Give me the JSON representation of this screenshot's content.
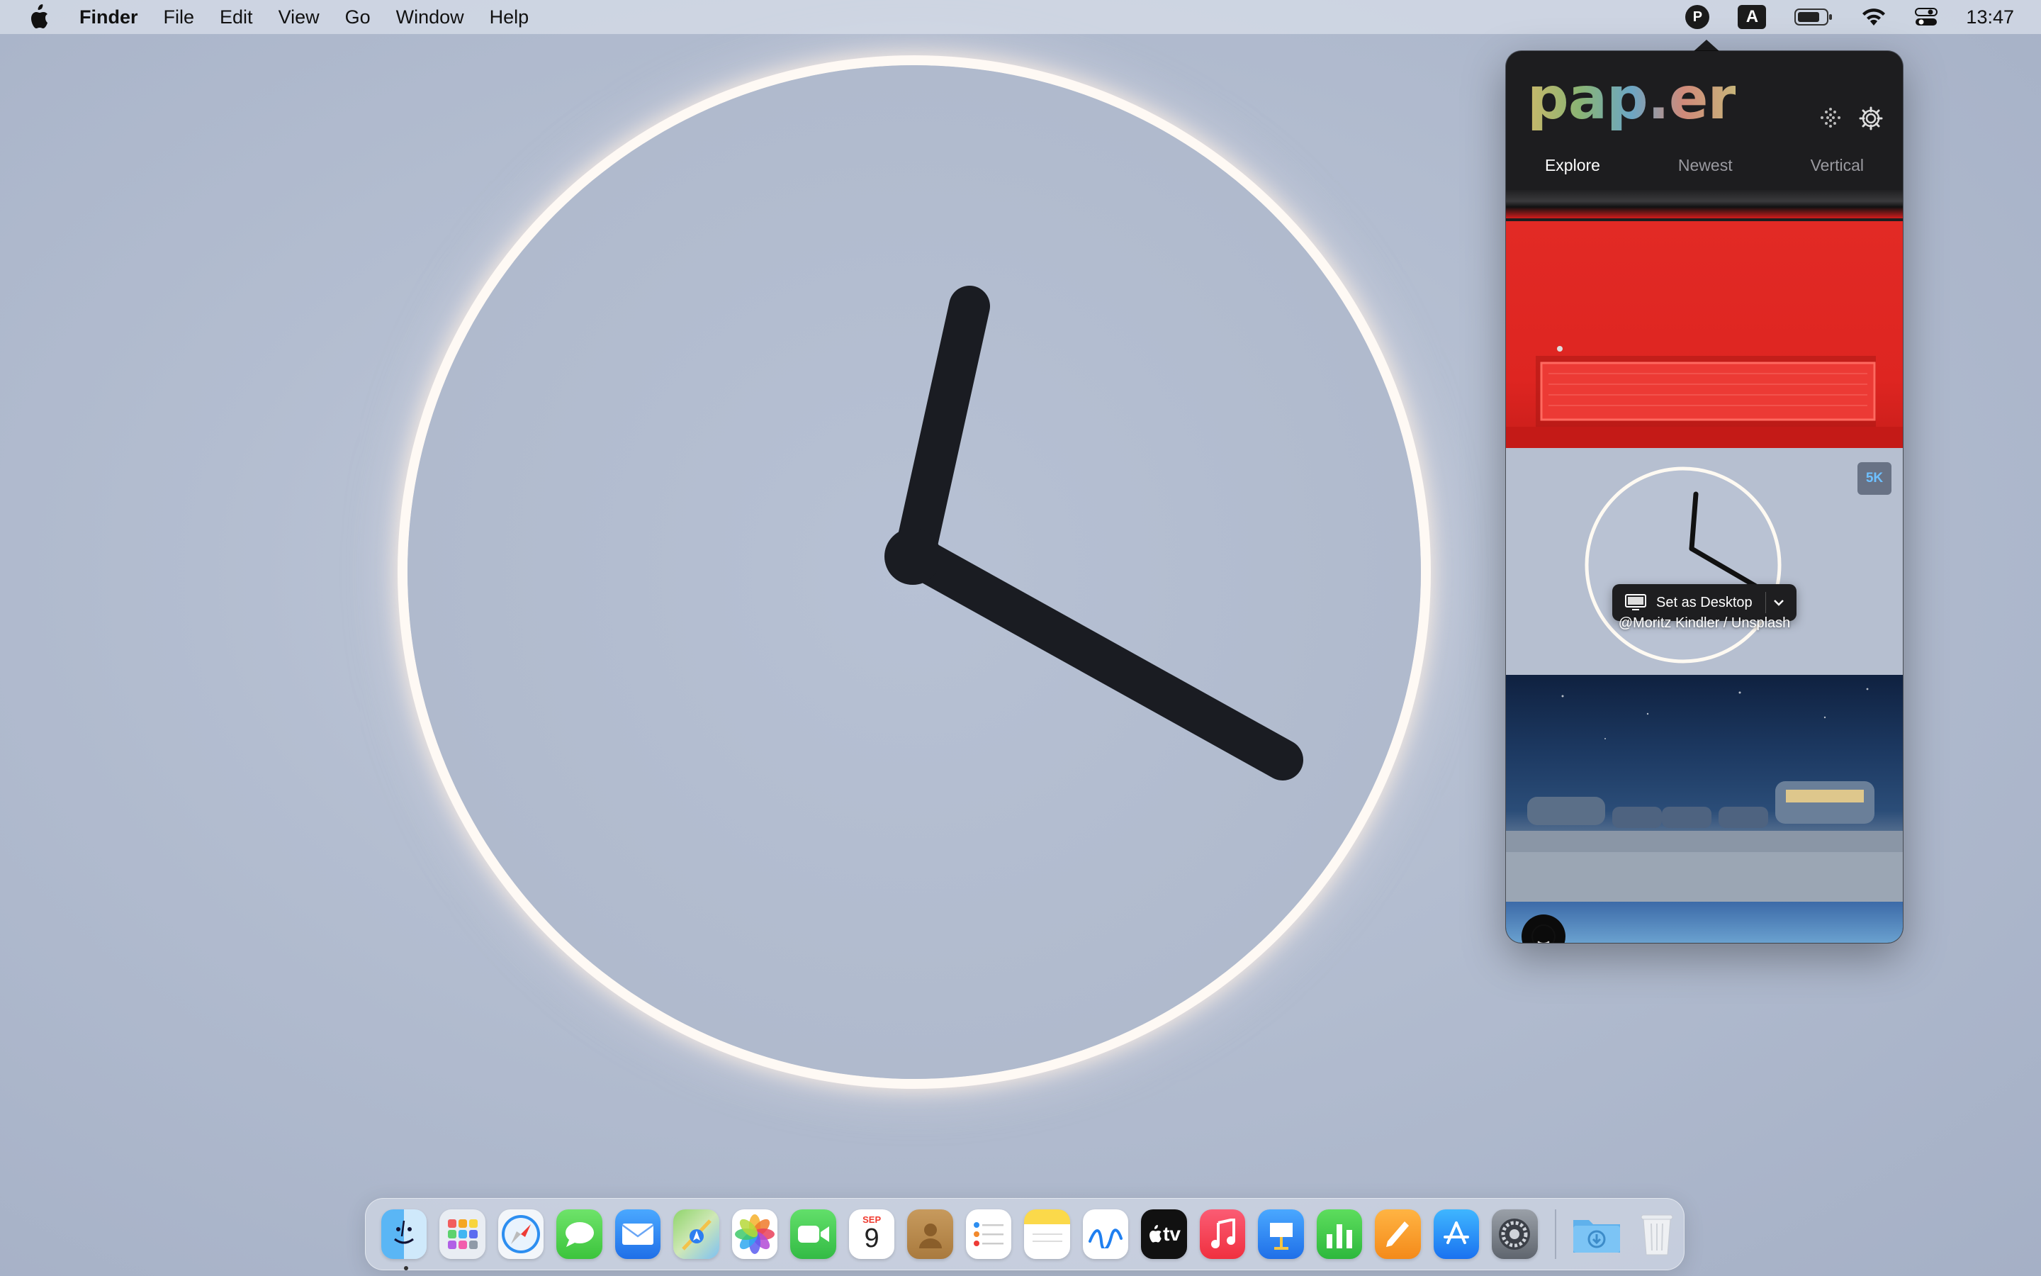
{
  "menubar": {
    "app_name": "Finder",
    "items": [
      "File",
      "Edit",
      "View",
      "Go",
      "Window",
      "Help"
    ],
    "paper_badge": "P",
    "input_source": "A",
    "clock": "13:47"
  },
  "panel": {
    "logo": "pap.er",
    "tabs": [
      "Explore",
      "Newest",
      "Vertical"
    ],
    "active_tab": "Explore",
    "resolution_badge": "5K",
    "set_desktop_label": "Set as Desktop",
    "credit": "@Moritz Kindler / Unsplash"
  },
  "dock": {
    "calendar_month": "SEP",
    "calendar_day": "9",
    "tv_label": "tv",
    "apps": [
      "finder-icon",
      "launchpad-icon",
      "safari-icon",
      "messages-icon",
      "mail-icon",
      "maps-icon",
      "photos-icon",
      "facetime-icon",
      "calendar-icon",
      "contacts-icon",
      "reminders-icon",
      "notes-icon",
      "freeform-icon",
      "apple-tv-icon",
      "music-icon",
      "keynote-icon",
      "numbers-icon",
      "pages-icon",
      "app-store-icon",
      "system-settings-icon",
      "downloads-folder-icon",
      "trash-icon"
    ]
  },
  "colors": {
    "accent_badge": "#6ec0ff",
    "panel_bg": "#1d1d1f"
  }
}
